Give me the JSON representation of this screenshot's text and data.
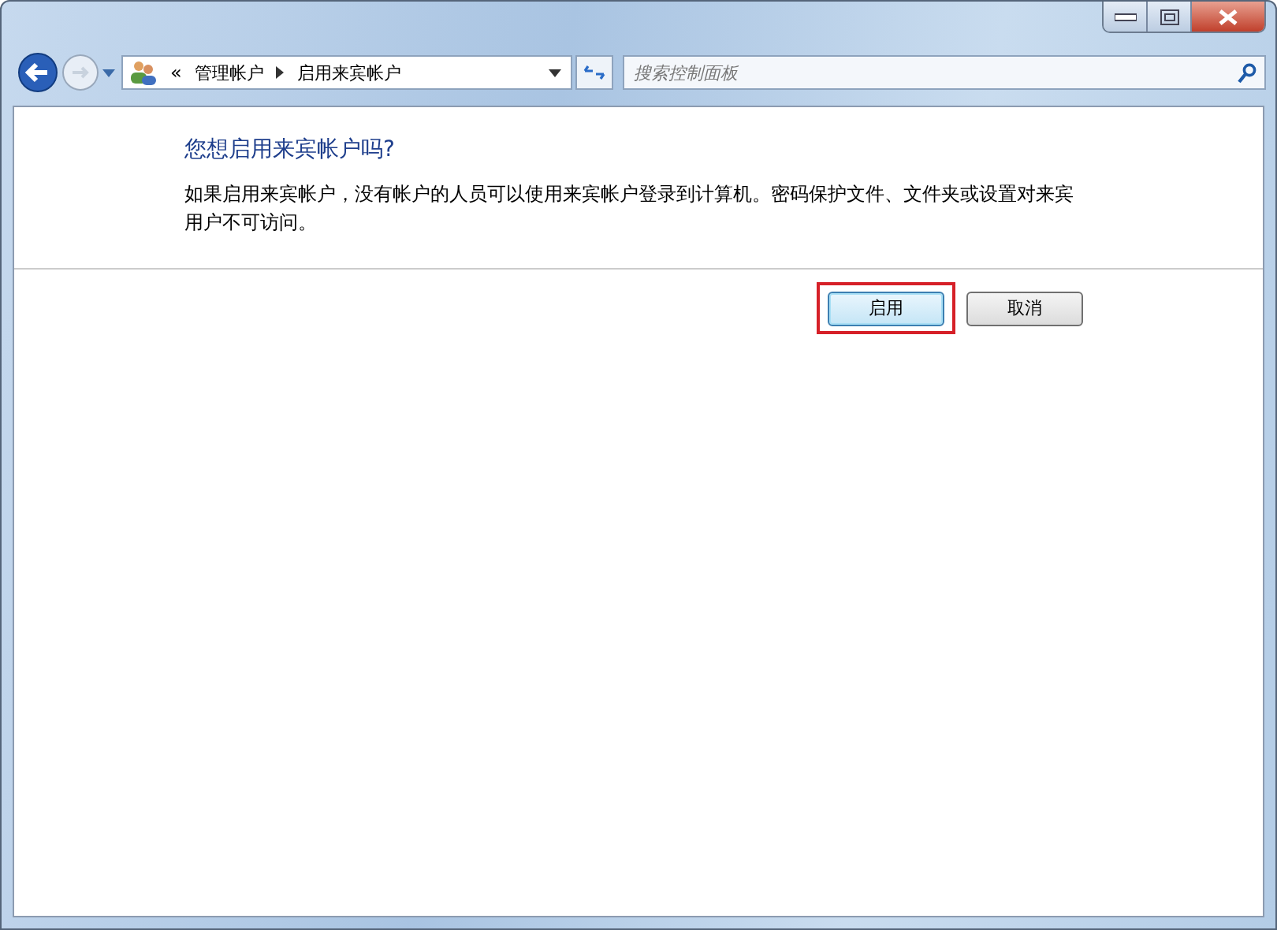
{
  "address_bar": {
    "overflow": "«",
    "crumbs": [
      "管理帐户",
      "启用来宾帐户"
    ]
  },
  "search": {
    "placeholder": "搜索控制面板"
  },
  "heading": "您想启用来宾帐户吗?",
  "description": "如果启用来宾帐户，没有帐户的人员可以使用来宾帐户登录到计算机。密码保护文件、文件夹或设置对来宾用户不可访问。",
  "buttons": [
    {
      "label": "启用",
      "highlighted": true,
      "focused": true
    },
    {
      "label": "取消",
      "highlighted": false,
      "focused": false
    }
  ]
}
